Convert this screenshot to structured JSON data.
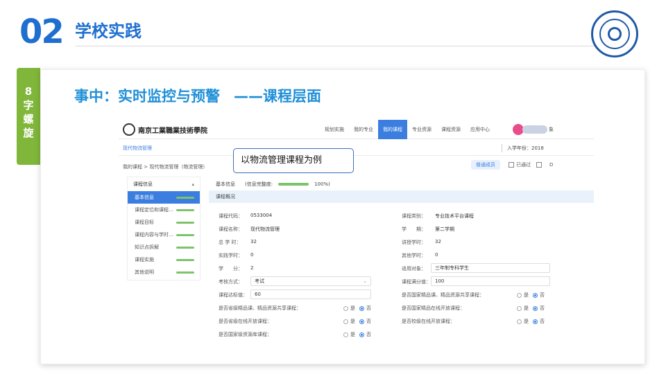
{
  "header": {
    "section_number": "02",
    "section_title": "学校实践"
  },
  "side_tab": {
    "chars": [
      "8",
      "字",
      "螺",
      "旋"
    ]
  },
  "card": {
    "title": "事中：实时监控与预警",
    "title_suffix": "——课程层面"
  },
  "callout": "以物流管理课程为例",
  "app": {
    "brand_name": "南京工業職業技術學院",
    "nav": [
      "规划实施",
      "我的专业",
      "我的课程",
      "专业资源",
      "课程资源",
      "应用中心"
    ],
    "nav_active_index": 2,
    "user_tail": "象",
    "crumb1": "现代物流管理",
    "enroll_year": "入学年份：2018",
    "crumb2": "我的课程 > 现代物流管理（物流管理）",
    "toolbar": {
      "tag": "普通成员",
      "approved": "已通过",
      "edit": "",
      "extra": "D"
    },
    "menu_head": "课程信息",
    "menu_items": [
      "基本信息",
      "课程定位和课程…",
      "课程目标",
      "课程内容与学时…",
      "知识点拆解",
      "课程实施",
      "其他说明"
    ],
    "menu_active_index": 0,
    "basic_info_label": "基本信息",
    "completeness_label": "(信息完整度:",
    "completeness_value": "100%)",
    "section_header": "课程概况",
    "fields": {
      "course_code_label": "课程代码：",
      "course_code": "0533004",
      "course_name_label": "课程名称：",
      "course_name": "现代物流管理",
      "total_hours_label": "总 学 时：",
      "total_hours": "32",
      "practice_hours_label": "实践学时：",
      "practice_hours": "0",
      "credits_label": "学　　分：",
      "credits": "2",
      "exam_label": "考核方式：",
      "exam_value": "考试",
      "pass_label": "课程达标值：",
      "pass_value": "60",
      "provincial_label": "是否省级精品课、精品资源共享课程：",
      "online_label": "是否省级在线开放课程：",
      "resource_label": "是否国家级资源库课程：",
      "category_label": "课程类别：",
      "category": "专业技术平台课程",
      "term_label": "学　　期：",
      "term": "第二学期",
      "lecture_hours_label": "讲授学时：",
      "lecture_hours": "32",
      "other_hours_label": "其他学时：",
      "other_hours": "0",
      "audience_label": "适用对象：",
      "audience": "三年制专科学生",
      "full_score_label": "课程满分值：",
      "full_score": "100",
      "national_label": "是否国家精品课、精品资源共享课程：",
      "national_online_label": "是否国家精品在线开放课程：",
      "school_online_label": "是否校级在线开放课程："
    },
    "radio_yes": "是",
    "radio_no": "否"
  }
}
